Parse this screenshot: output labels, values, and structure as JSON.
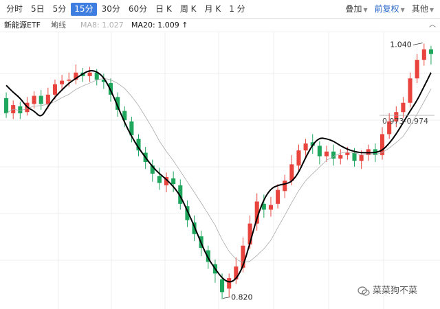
{
  "toolbar": {
    "tabs": [
      {
        "label": "分时"
      },
      {
        "label": "5日"
      },
      {
        "label": "5分"
      },
      {
        "label": "15分",
        "active": true
      },
      {
        "label": "30分"
      },
      {
        "label": "60分"
      },
      {
        "label": "日 K"
      },
      {
        "label": "周 K"
      },
      {
        "label": "月 K"
      },
      {
        "label": "1 分"
      }
    ],
    "overlay_label": "叠加",
    "adjust_label": "前复权",
    "other_label": "其他"
  },
  "legend": {
    "name": "新能源ETF",
    "ma_type": "均线",
    "ma8_label": "MA8: 1.027",
    "ma20_label": "MA20: 1.009 ↑"
  },
  "colors": {
    "up": "#e8433c",
    "down": "#1ea65d",
    "ma20": "#000000",
    "ma8": "#aaaaaa",
    "grid": "#eeeeee",
    "accent": "#3e7ee0"
  },
  "watermark": "菜菜狗不菜",
  "chart_data": {
    "type": "candlestick",
    "title": "新能源ETF",
    "indicators": [
      "MA8",
      "MA20"
    ],
    "ylim": [
      0.815,
      1.045
    ],
    "annotations": [
      {
        "label": "1.040",
        "value": 1.04
      },
      {
        "label": "0.820",
        "value": 0.82
      },
      {
        "label": "0.973-0.974",
        "value": 0.9735
      }
    ],
    "ma20": [
      1.004,
      0.998,
      0.993,
      0.985,
      0.982,
      0.976,
      0.986,
      0.994,
      1.0,
      1.006,
      1.01,
      1.014,
      1.017,
      1.016,
      1.011,
      1.0,
      0.986,
      0.972,
      0.96,
      0.95,
      0.942,
      0.934,
      0.928,
      0.923,
      0.917,
      0.909,
      0.896,
      0.883,
      0.868,
      0.855,
      0.846,
      0.838,
      0.834,
      0.837,
      0.848,
      0.868,
      0.89,
      0.906,
      0.915,
      0.918,
      0.919,
      0.921,
      0.929,
      0.942,
      0.953,
      0.959,
      0.958,
      0.956,
      0.952,
      0.949,
      0.947,
      0.946,
      0.946,
      0.946,
      0.948,
      0.954,
      0.962,
      0.972,
      0.982,
      0.991,
      1.003,
      1.015
    ],
    "candles": [
      [
        0.993,
        0.98,
        0.998,
        0.976
      ],
      [
        0.98,
        0.987,
        0.991,
        0.975
      ],
      [
        0.986,
        0.98,
        0.99,
        0.975
      ],
      [
        0.981,
        0.989,
        0.994,
        0.978
      ],
      [
        0.988,
        0.995,
        0.999,
        0.984
      ],
      [
        0.995,
        0.988,
        1.0,
        0.983
      ],
      [
        0.988,
        0.996,
        1.002,
        0.984
      ],
      [
        0.996,
        1.005,
        1.009,
        0.992
      ],
      [
        1.005,
        1.008,
        1.013,
        1.0
      ],
      [
        1.008,
        1.009,
        1.015,
        1.003
      ],
      [
        1.009,
        1.015,
        1.022,
        1.005
      ],
      [
        1.015,
        1.012,
        1.019,
        1.007
      ],
      [
        1.012,
        1.015,
        1.02,
        1.007
      ],
      [
        1.015,
        1.009,
        1.018,
        1.004
      ],
      [
        1.009,
        1.007,
        1.014,
        1.001
      ],
      [
        1.006,
        0.996,
        1.01,
        0.99
      ],
      [
        0.994,
        0.983,
        0.998,
        0.977
      ],
      [
        0.982,
        0.974,
        0.986,
        0.968
      ],
      [
        0.973,
        0.961,
        0.977,
        0.955
      ],
      [
        0.958,
        0.948,
        0.962,
        0.943
      ],
      [
        0.946,
        0.938,
        0.951,
        0.932
      ],
      [
        0.935,
        0.928,
        0.94,
        0.921
      ],
      [
        0.926,
        0.92,
        0.933,
        0.914
      ],
      [
        0.918,
        0.925,
        0.929,
        0.912
      ],
      [
        0.924,
        0.919,
        0.93,
        0.912
      ],
      [
        0.918,
        0.902,
        0.923,
        0.897
      ],
      [
        0.9,
        0.888,
        0.905,
        0.882
      ],
      [
        0.886,
        0.876,
        0.892,
        0.87
      ],
      [
        0.874,
        0.864,
        0.879,
        0.857
      ],
      [
        0.862,
        0.852,
        0.866,
        0.846
      ],
      [
        0.85,
        0.842,
        0.854,
        0.834
      ],
      [
        0.837,
        0.826,
        0.842,
        0.82
      ],
      [
        0.829,
        0.838,
        0.842,
        0.822
      ],
      [
        0.837,
        0.848,
        0.856,
        0.833
      ],
      [
        0.847,
        0.866,
        0.873,
        0.843
      ],
      [
        0.867,
        0.885,
        0.892,
        0.863
      ],
      [
        0.885,
        0.904,
        0.911,
        0.879
      ],
      [
        0.902,
        0.897,
        0.91,
        0.89
      ],
      [
        0.897,
        0.901,
        0.908,
        0.891
      ],
      [
        0.902,
        0.914,
        0.919,
        0.898
      ],
      [
        0.913,
        0.922,
        0.927,
        0.907
      ],
      [
        0.922,
        0.936,
        0.944,
        0.918
      ],
      [
        0.935,
        0.948,
        0.953,
        0.93
      ],
      [
        0.948,
        0.954,
        0.958,
        0.941
      ],
      [
        0.955,
        0.952,
        0.962,
        0.945
      ],
      [
        0.952,
        0.943,
        0.956,
        0.936
      ],
      [
        0.943,
        0.947,
        0.952,
        0.938
      ],
      [
        0.947,
        0.941,
        0.953,
        0.935
      ],
      [
        0.941,
        0.944,
        0.949,
        0.936
      ],
      [
        0.944,
        0.946,
        0.951,
        0.94
      ],
      [
        0.946,
        0.939,
        0.95,
        0.934
      ],
      [
        0.939,
        0.944,
        0.948,
        0.932
      ],
      [
        0.944,
        0.949,
        0.953,
        0.939
      ],
      [
        0.949,
        0.944,
        0.954,
        0.938
      ],
      [
        0.944,
        0.962,
        0.968,
        0.94
      ],
      [
        0.962,
        0.973,
        0.98,
        0.958
      ],
      [
        0.973,
        0.981,
        0.986,
        0.968
      ],
      [
        0.981,
        0.989,
        0.994,
        0.976
      ],
      [
        0.989,
        1.01,
        1.015,
        0.985
      ],
      [
        1.01,
        1.026,
        1.031,
        1.006
      ],
      [
        1.026,
        1.035,
        1.04,
        1.021
      ],
      [
        1.035,
        1.031,
        1.038,
        1.022
      ]
    ],
    "candle_fields": [
      "open",
      "close",
      "high",
      "low"
    ]
  }
}
